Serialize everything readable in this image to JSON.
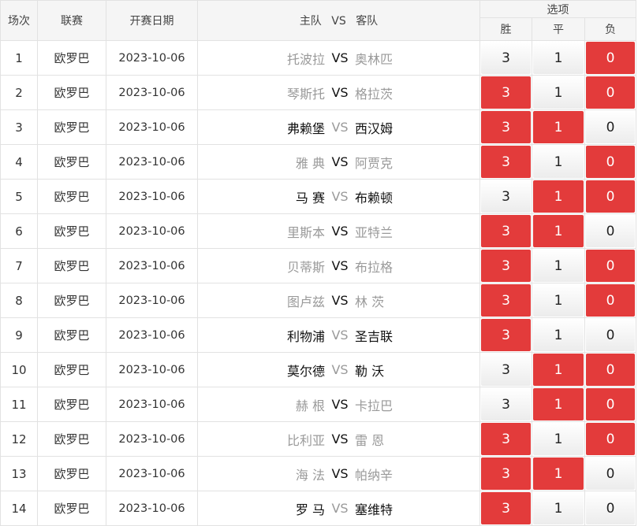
{
  "headers": {
    "index": "场次",
    "league": "联赛",
    "date": "开赛日期",
    "match_home": "主队",
    "match_vs": "VS",
    "match_away": "客队",
    "options": "选项",
    "win": "胜",
    "draw": "平",
    "lose": "负"
  },
  "vs_label": "VS",
  "colors": {
    "selected": "#e33b3b",
    "header_bg": "#f5f5f5"
  },
  "rows": [
    {
      "idx": "1",
      "league": "欧罗巴",
      "date": "2023-10-06",
      "home": "托波拉",
      "away": "奥林匹",
      "home_strong": false,
      "away_strong": false,
      "win": "3",
      "draw": "1",
      "lose": "0",
      "sel": [
        false,
        false,
        true
      ]
    },
    {
      "idx": "2",
      "league": "欧罗巴",
      "date": "2023-10-06",
      "home": "琴斯托",
      "away": "格拉茨",
      "home_strong": false,
      "away_strong": false,
      "win": "3",
      "draw": "1",
      "lose": "0",
      "sel": [
        true,
        false,
        true
      ]
    },
    {
      "idx": "3",
      "league": "欧罗巴",
      "date": "2023-10-06",
      "home": "弗赖堡",
      "away": "西汉姆",
      "home_strong": true,
      "away_strong": true,
      "win": "3",
      "draw": "1",
      "lose": "0",
      "sel": [
        true,
        true,
        false
      ]
    },
    {
      "idx": "4",
      "league": "欧罗巴",
      "date": "2023-10-06",
      "home": "雅 典",
      "away": "阿贾克",
      "home_strong": false,
      "away_strong": false,
      "win": "3",
      "draw": "1",
      "lose": "0",
      "sel": [
        true,
        false,
        true
      ]
    },
    {
      "idx": "5",
      "league": "欧罗巴",
      "date": "2023-10-06",
      "home": "马 赛",
      "away": "布赖顿",
      "home_strong": true,
      "away_strong": true,
      "win": "3",
      "draw": "1",
      "lose": "0",
      "sel": [
        false,
        true,
        true
      ]
    },
    {
      "idx": "6",
      "league": "欧罗巴",
      "date": "2023-10-06",
      "home": "里斯本",
      "away": "亚特兰",
      "home_strong": false,
      "away_strong": false,
      "win": "3",
      "draw": "1",
      "lose": "0",
      "sel": [
        true,
        true,
        false
      ]
    },
    {
      "idx": "7",
      "league": "欧罗巴",
      "date": "2023-10-06",
      "home": "贝蒂斯",
      "away": "布拉格",
      "home_strong": false,
      "away_strong": false,
      "win": "3",
      "draw": "1",
      "lose": "0",
      "sel": [
        true,
        false,
        true
      ]
    },
    {
      "idx": "8",
      "league": "欧罗巴",
      "date": "2023-10-06",
      "home": "图卢兹",
      "away": "林 茨",
      "home_strong": false,
      "away_strong": false,
      "win": "3",
      "draw": "1",
      "lose": "0",
      "sel": [
        true,
        false,
        true
      ]
    },
    {
      "idx": "9",
      "league": "欧罗巴",
      "date": "2023-10-06",
      "home": "利物浦",
      "away": "圣吉联",
      "home_strong": true,
      "away_strong": true,
      "win": "3",
      "draw": "1",
      "lose": "0",
      "sel": [
        true,
        false,
        false
      ]
    },
    {
      "idx": "10",
      "league": "欧罗巴",
      "date": "2023-10-06",
      "home": "莫尔德",
      "away": "勒 沃",
      "home_strong": true,
      "away_strong": true,
      "win": "3",
      "draw": "1",
      "lose": "0",
      "sel": [
        false,
        true,
        true
      ]
    },
    {
      "idx": "11",
      "league": "欧罗巴",
      "date": "2023-10-06",
      "home": "赫 根",
      "away": "卡拉巴",
      "home_strong": false,
      "away_strong": false,
      "win": "3",
      "draw": "1",
      "lose": "0",
      "sel": [
        false,
        true,
        true
      ]
    },
    {
      "idx": "12",
      "league": "欧罗巴",
      "date": "2023-10-06",
      "home": "比利亚",
      "away": "雷 恩",
      "home_strong": false,
      "away_strong": false,
      "win": "3",
      "draw": "1",
      "lose": "0",
      "sel": [
        true,
        false,
        true
      ]
    },
    {
      "idx": "13",
      "league": "欧罗巴",
      "date": "2023-10-06",
      "home": "海 法",
      "away": "帕纳辛",
      "home_strong": false,
      "away_strong": false,
      "win": "3",
      "draw": "1",
      "lose": "0",
      "sel": [
        true,
        true,
        false
      ]
    },
    {
      "idx": "14",
      "league": "欧罗巴",
      "date": "2023-10-06",
      "home": "罗 马",
      "away": "塞维特",
      "home_strong": true,
      "away_strong": true,
      "win": "3",
      "draw": "1",
      "lose": "0",
      "sel": [
        true,
        false,
        false
      ]
    }
  ]
}
